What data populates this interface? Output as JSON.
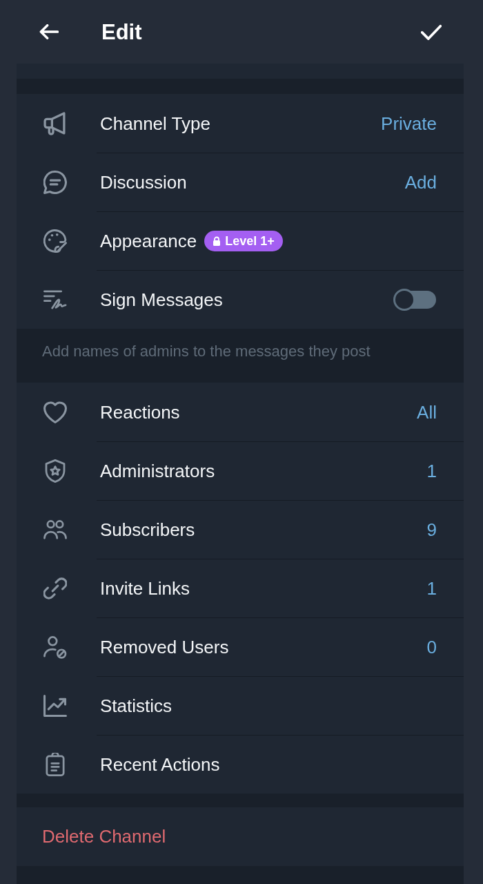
{
  "top_bar": {
    "title": "Edit"
  },
  "settings_group": {
    "rows": [
      {
        "kind": "value",
        "label": "Channel Type",
        "value": "Private"
      },
      {
        "kind": "value",
        "label": "Discussion",
        "value": "Add"
      },
      {
        "kind": "badge",
        "label": "Appearance",
        "badge": "Level 1+"
      },
      {
        "kind": "toggle",
        "label": "Sign Messages",
        "on": false
      }
    ],
    "hint": "Add names of admins to the messages they post"
  },
  "management_group": {
    "rows": [
      {
        "kind": "value",
        "label": "Reactions",
        "value": "All"
      },
      {
        "kind": "value",
        "label": "Administrators",
        "value": "1"
      },
      {
        "kind": "value",
        "label": "Subscribers",
        "value": "9"
      },
      {
        "kind": "value",
        "label": "Invite Links",
        "value": "1"
      },
      {
        "kind": "value",
        "label": "Removed Users",
        "value": "0"
      },
      {
        "kind": "plain",
        "label": "Statistics"
      },
      {
        "kind": "plain",
        "label": "Recent Actions"
      }
    ]
  },
  "delete_channel": {
    "label": "Delete Channel"
  }
}
